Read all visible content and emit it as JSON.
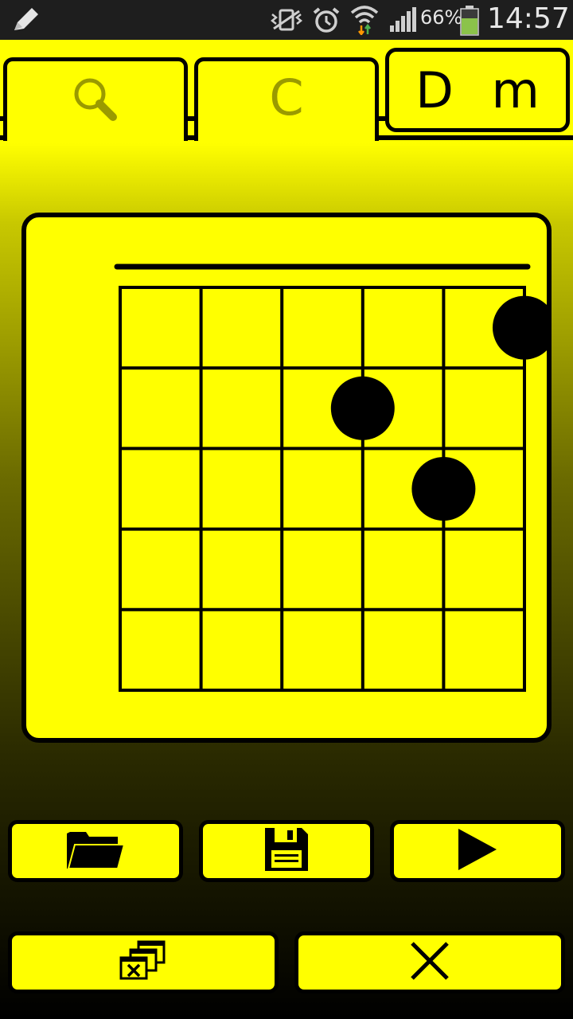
{
  "status_bar": {
    "battery_percent": "66%",
    "time": "14:57",
    "icons": [
      "pencil-icon",
      "vibrate-icon",
      "alarm-icon",
      "wifi-icon",
      "signal-icon",
      "battery-icon"
    ]
  },
  "tabs": [
    {
      "name": "search",
      "label": "",
      "icon": "search-icon",
      "active": false
    },
    {
      "name": "root-note",
      "label": "C",
      "active": false
    },
    {
      "name": "chord-type",
      "label": "D m",
      "active": true
    }
  ],
  "chord_diagram": {
    "strings": 6,
    "frets": 5,
    "dots": [
      {
        "string": 6,
        "fret": 1
      },
      {
        "string": 4,
        "fret": 2
      },
      {
        "string": 5,
        "fret": 3
      }
    ]
  },
  "buttons": [
    {
      "name": "open",
      "icon": "folder-icon"
    },
    {
      "name": "save",
      "icon": "floppy-disk-icon"
    },
    {
      "name": "play",
      "icon": "play-icon"
    },
    {
      "name": "clear",
      "icon": "clear-windows-icon"
    },
    {
      "name": "close",
      "icon": "close-icon"
    }
  ],
  "colors": {
    "accent": "#ffff00",
    "ink": "#000000",
    "inactive_text": "#9a9a00"
  }
}
